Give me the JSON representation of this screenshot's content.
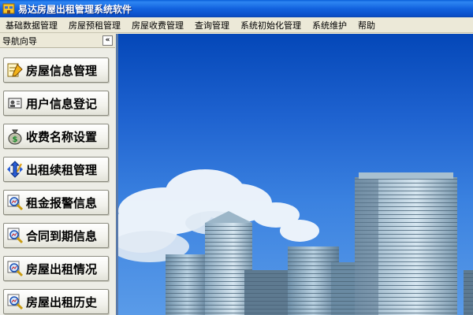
{
  "window": {
    "title": "易达房屋出租管理系统软件"
  },
  "menu": [
    "基础数据管理",
    "房屋预租管理",
    "房屋收费管理",
    "查询管理",
    "系统初始化管理",
    "系统维护",
    "帮助"
  ],
  "nav": {
    "title": "导航向导",
    "collapse_label": "«",
    "items": [
      {
        "label": "房屋信息管理",
        "icon": "house-edit-icon"
      },
      {
        "label": "用户信息登记",
        "icon": "user-card-icon"
      },
      {
        "label": "收费名称设置",
        "icon": "money-bag-icon"
      },
      {
        "label": "出租续租管理",
        "icon": "arrows-edit-icon"
      },
      {
        "label": "租金报警信息",
        "icon": "magnifier-chart-icon"
      },
      {
        "label": "合同到期信息",
        "icon": "magnifier-chart-icon"
      },
      {
        "label": "房屋出租情况",
        "icon": "magnifier-chart-icon"
      },
      {
        "label": "房屋出租历史",
        "icon": "magnifier-chart-icon"
      }
    ]
  },
  "colors": {
    "titlebar": "#0A5FD8",
    "sky": "#1F63D0",
    "panel": "#ECE9D8"
  }
}
